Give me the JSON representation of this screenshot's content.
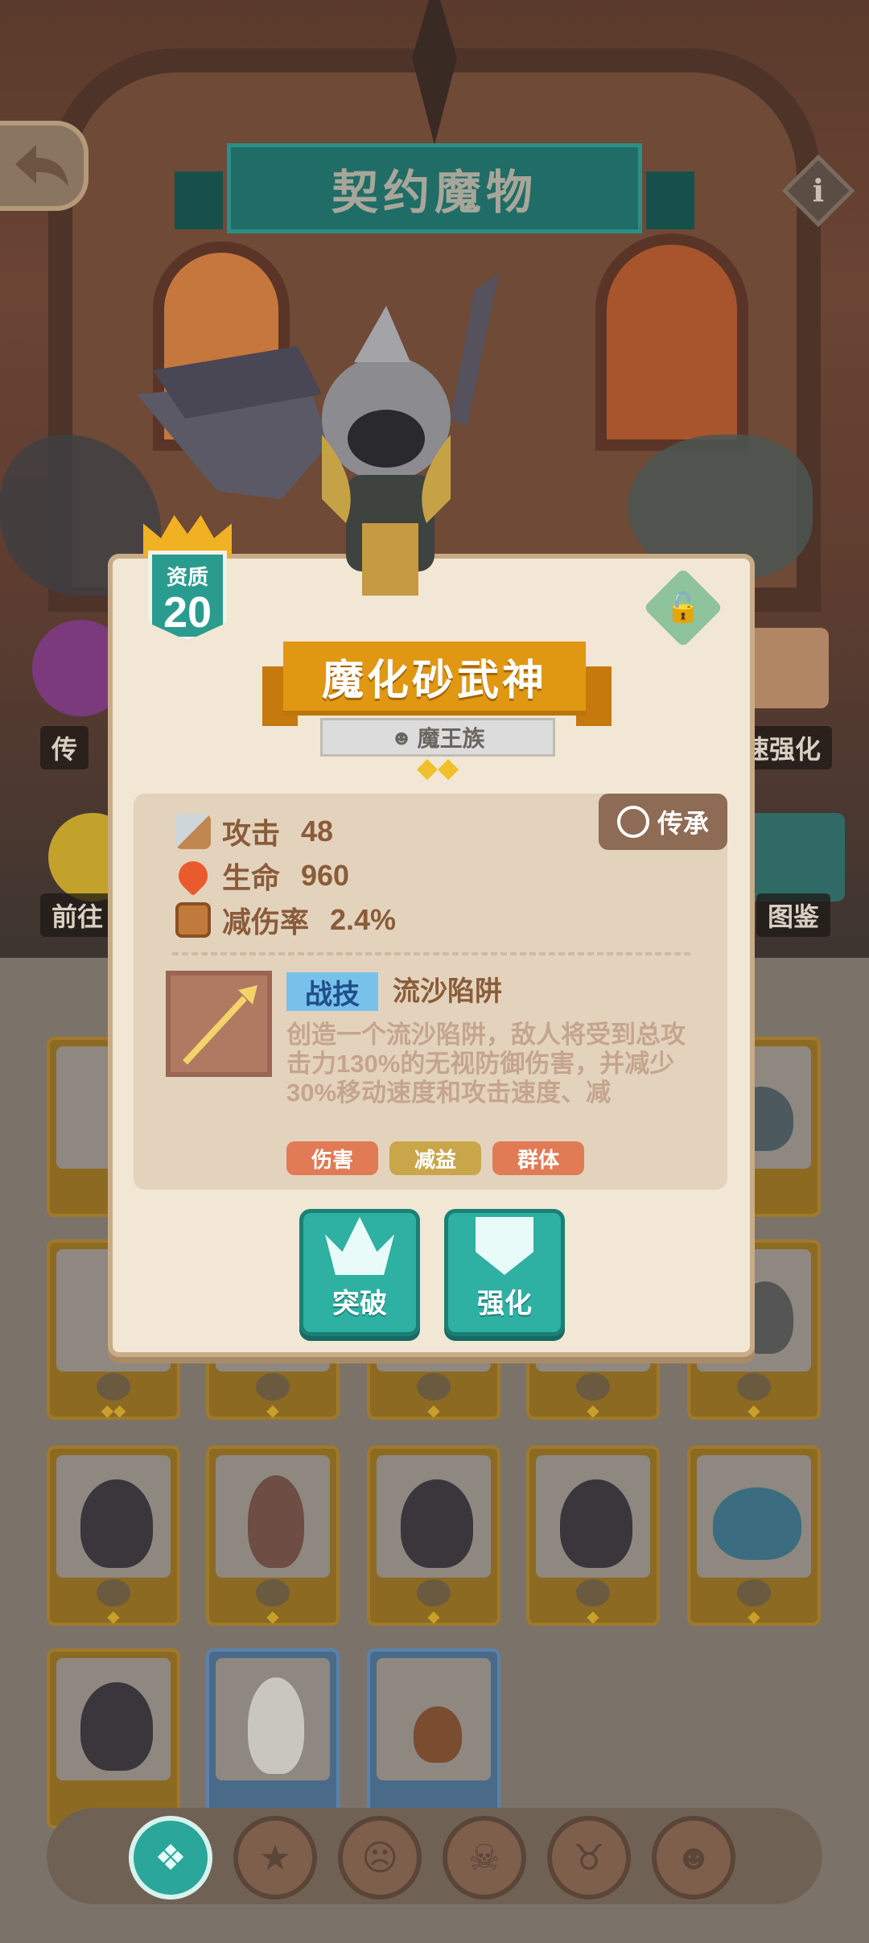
{
  "header": {
    "title": "契约魔物"
  },
  "side_labels": {
    "left_top": "传",
    "left_bottom": "前往",
    "right_top": "速强化",
    "right_bottom": "图鉴"
  },
  "monster": {
    "grade_label": "资质",
    "grade_value": "20",
    "name": "魔化砂武神",
    "race": "魔王族",
    "star_rating": 2,
    "inherit_label": "传承",
    "stats": [
      {
        "label": "攻击",
        "value": "48",
        "icon": "sword-icon"
      },
      {
        "label": "生命",
        "value": "960",
        "icon": "heart-icon"
      },
      {
        "label": "减伤率",
        "value": "2.4%",
        "icon": "shield-icon"
      }
    ],
    "skill": {
      "type": "战技",
      "name": "流沙陷阱",
      "description": "创造一个流沙陷阱，敌人将受到总攻击力130%的无视防御伤害，并减少30%移动速度和攻击速度、减",
      "tags": [
        "伤害",
        "减益",
        "群体"
      ]
    },
    "actions": {
      "breakthrough": "突破",
      "enhance": "强化"
    }
  },
  "colors": {
    "teal": "#2eb0a2",
    "orange": "#e09712",
    "panel": "#f1e7d4",
    "tag_damage": "#e07b56",
    "tag_debuff": "#c9a64a",
    "tag_group": "#e07b56"
  },
  "bottom_nav": [
    "all-monsters-icon",
    "star-egg-icon",
    "demon-face-icon",
    "flame-skull-icon",
    "horned-skull-icon",
    "devil-face-icon"
  ]
}
